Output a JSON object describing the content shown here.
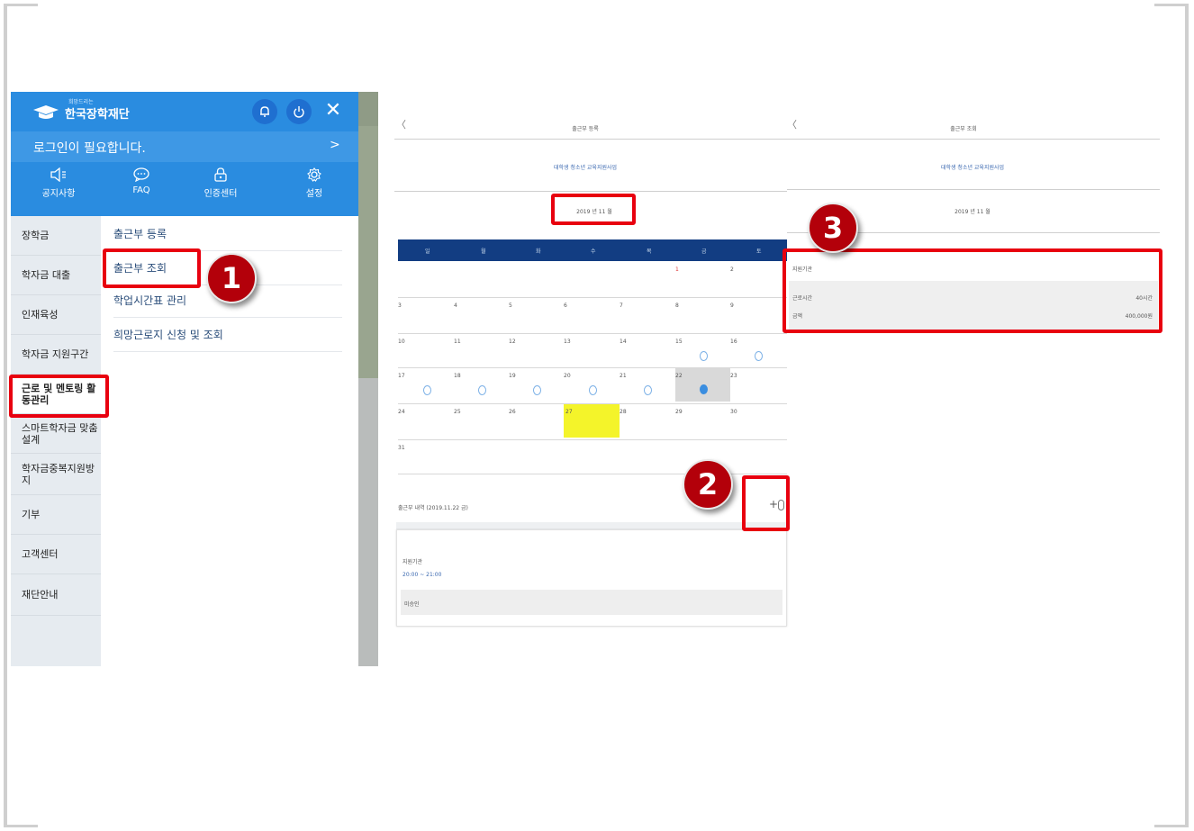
{
  "menu": {
    "logo_sub": "희망드리는",
    "logo_text": "한국장학재단",
    "login_text": "로그인이 필요합니다.",
    "login_chevron": ">",
    "close_glyph": "✕",
    "quick_links": [
      {
        "label": "공지사항",
        "icon": "speaker-icon"
      },
      {
        "label": "FAQ",
        "icon": "chat-icon"
      },
      {
        "label": "인증센터",
        "icon": "lock-icon"
      },
      {
        "label": "설정",
        "icon": "gear-icon"
      }
    ],
    "side_items": [
      {
        "label": "장학금"
      },
      {
        "label": "학자금 대출"
      },
      {
        "label": "인재육성"
      },
      {
        "label": "학자금 지원구간"
      },
      {
        "label": "근로 및 멘토링 활동관리"
      },
      {
        "label": "스마트학자금 맞춤설계"
      },
      {
        "label": "학자금중복지원방지"
      },
      {
        "label": "기부"
      },
      {
        "label": "고객센터"
      },
      {
        "label": "재단안내"
      }
    ],
    "sub_items": [
      {
        "label": "출근부 등록"
      },
      {
        "label": "출근부 조회"
      },
      {
        "label": "학업시간표 관리"
      },
      {
        "label": "희망근로지 신청 및 조회"
      }
    ]
  },
  "badges": {
    "one": "1",
    "two": "2",
    "three": "3"
  },
  "calendar_screen": {
    "back": "〈",
    "title": "출근부 등록",
    "program": "대학생 청소년 교육지원사업",
    "year_month": "2019 년 11 월",
    "weekdays": [
      "일",
      "월",
      "화",
      "수",
      "목",
      "금",
      "토"
    ],
    "weeks": [
      [
        "",
        "",
        "",
        "",
        "",
        "1",
        "2"
      ],
      [
        "3",
        "4",
        "5",
        "6",
        "7",
        "8",
        "9"
      ],
      [
        "10",
        "11",
        "12",
        "13",
        "14",
        "15",
        "16"
      ],
      [
        "17",
        "18",
        "19",
        "20",
        "21",
        "22",
        "23"
      ],
      [
        "24",
        "25",
        "26",
        "27",
        "28",
        "29",
        "30"
      ],
      [
        "31",
        "",
        "",
        "",
        "",
        "",
        ""
      ]
    ],
    "list_label": "출근부 내역 (2019.11.22 금)",
    "plus": "+",
    "card_field_label": "지원기관",
    "card_time": "20:00 ~ 21:00",
    "card_status": "미승인"
  },
  "view_screen": {
    "back": "〈",
    "title": "출근부 조회",
    "program": "대학생 청소년 교육지원사업",
    "year_month": "2019 년 11 월",
    "panel_label": "지원기관",
    "rows": [
      {
        "label": "근로시간",
        "value": "40시간"
      },
      {
        "label": "금액",
        "value": "400,000원"
      }
    ]
  },
  "colors": {
    "menu_blue": "#2a8ce0",
    "calendar_header": "#123d82",
    "highlight": "#e8000f",
    "badge": "#b3000a",
    "selected_day": "#f4f42a"
  }
}
